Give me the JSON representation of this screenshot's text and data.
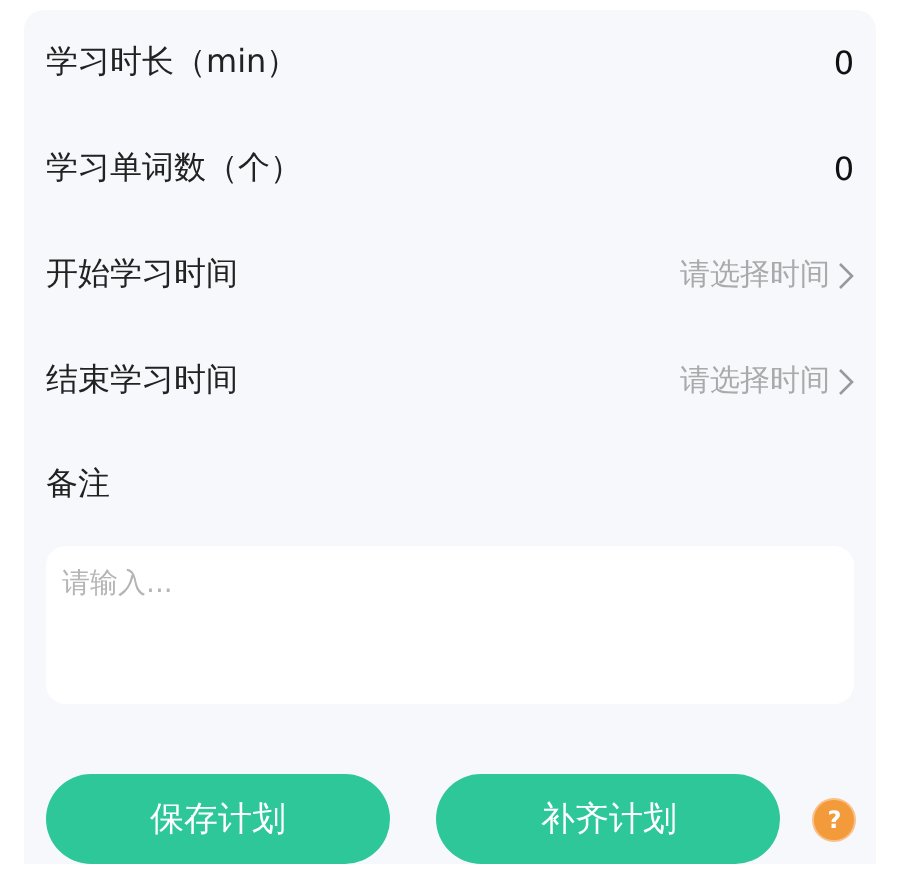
{
  "fields": [
    {
      "kind": "value",
      "label": "学习时长（min）",
      "value": "0"
    },
    {
      "kind": "value",
      "label": "学习单词数（个）",
      "value": "0"
    },
    {
      "kind": "picker",
      "label": "开始学习时间",
      "placeholder": "请选择时间"
    },
    {
      "kind": "picker",
      "label": "结束学习时间",
      "placeholder": "请选择时间"
    }
  ],
  "note": {
    "label": "备注",
    "placeholder": "请输入..."
  },
  "buttons": [
    "保存计划",
    "补齐计划"
  ],
  "help": "?"
}
